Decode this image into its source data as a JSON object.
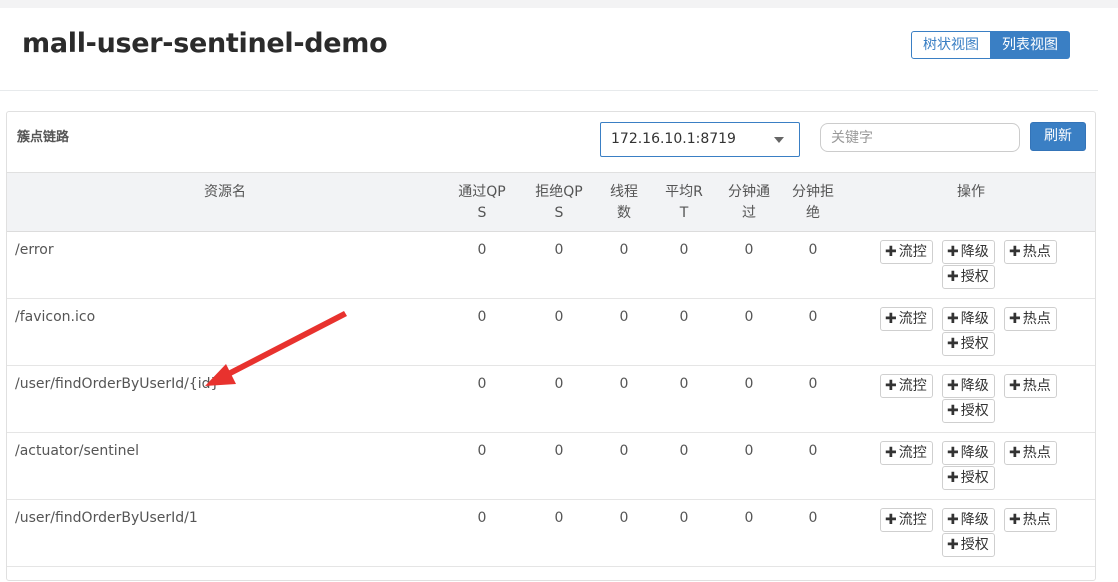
{
  "header": {
    "app_title": "mall-user-sentinel-demo",
    "view_toggle": {
      "tree_label": "树状视图",
      "list_label": "列表视图",
      "active": "list"
    }
  },
  "panel": {
    "title": "簇点链路",
    "machine_select": {
      "value": "172.16.10.1:8719"
    },
    "search": {
      "placeholder": "关键字",
      "value": ""
    },
    "refresh_label": "刷新"
  },
  "table": {
    "headers": {
      "resource": "资源名",
      "pass_qps": "通过QPS",
      "block_qps": "拒绝QPS",
      "threads": "线程数",
      "avg_rt": "平均RT",
      "minute_pass": "分钟通过",
      "minute_block": "分钟拒绝",
      "ops": "操作"
    },
    "op_labels": {
      "flow": "流控",
      "degrade": "降级",
      "hotspot": "热点",
      "auth": "授权"
    },
    "rows": [
      {
        "resource": "/error",
        "pass_qps": "0",
        "block_qps": "0",
        "threads": "0",
        "avg_rt": "0",
        "minute_pass": "0",
        "minute_block": "0"
      },
      {
        "resource": "/favicon.ico",
        "pass_qps": "0",
        "block_qps": "0",
        "threads": "0",
        "avg_rt": "0",
        "minute_pass": "0",
        "minute_block": "0"
      },
      {
        "resource": "/user/findOrderByUserId/{id}",
        "pass_qps": "0",
        "block_qps": "0",
        "threads": "0",
        "avg_rt": "0",
        "minute_pass": "0",
        "minute_block": "0"
      },
      {
        "resource": "/actuator/sentinel",
        "pass_qps": "0",
        "block_qps": "0",
        "threads": "0",
        "avg_rt": "0",
        "minute_pass": "0",
        "minute_block": "0"
      },
      {
        "resource": "/user/findOrderByUserId/1",
        "pass_qps": "0",
        "block_qps": "0",
        "threads": "0",
        "avg_rt": "0",
        "minute_pass": "0",
        "minute_block": "0"
      }
    ]
  },
  "annotation": {
    "color": "#e8322e",
    "points_to": "/user/findOrderByUserId/{id}"
  },
  "colors": {
    "primary": "#3a7fc4",
    "header_bg": "#f2f3f5"
  }
}
